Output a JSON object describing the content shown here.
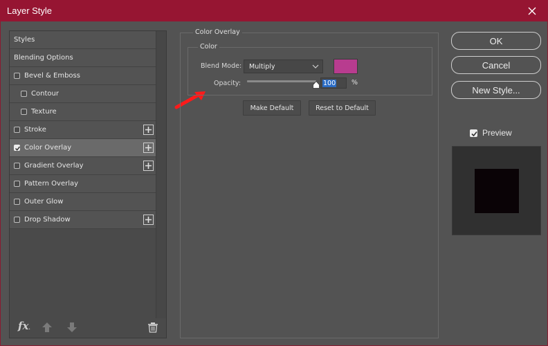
{
  "window": {
    "title": "Layer Style"
  },
  "left_panel": {
    "items": [
      {
        "label": "Styles",
        "type": "header"
      },
      {
        "label": "Blending Options",
        "type": "header"
      },
      {
        "label": "Bevel & Emboss",
        "type": "check",
        "checked": false
      },
      {
        "label": "Contour",
        "type": "check",
        "checked": false,
        "indent": true
      },
      {
        "label": "Texture",
        "type": "check",
        "checked": false,
        "indent": true
      },
      {
        "label": "Stroke",
        "type": "check",
        "checked": false,
        "plus": true
      },
      {
        "label": "Color Overlay",
        "type": "check",
        "checked": true,
        "plus": true,
        "selected": true
      },
      {
        "label": "Gradient Overlay",
        "type": "check",
        "checked": false,
        "plus": true
      },
      {
        "label": "Pattern Overlay",
        "type": "check",
        "checked": false
      },
      {
        "label": "Outer Glow",
        "type": "check",
        "checked": false
      },
      {
        "label": "Drop Shadow",
        "type": "check",
        "checked": false,
        "plus": true
      }
    ],
    "footer": {
      "fx_label": "fx",
      "fx_sub": "."
    }
  },
  "color_overlay": {
    "section_title": "Color Overlay",
    "group_title": "Color",
    "blend_mode_label": "Blend Mode:",
    "blend_mode_value": "Multiply",
    "overlay_color": "#b83c8f",
    "opacity_label": "Opacity:",
    "opacity_value": "100",
    "opacity_percent": 100,
    "opacity_unit": "%",
    "make_default_label": "Make Default",
    "reset_default_label": "Reset to Default"
  },
  "right_panel": {
    "ok_label": "OK",
    "cancel_label": "Cancel",
    "new_style_label": "New Style...",
    "preview_label": "Preview",
    "preview_checked": true,
    "preview_swatch_color": "#0a0306"
  },
  "colors": {
    "titlebar": "#961532",
    "annotation_arrow": "#ff1a1a"
  }
}
